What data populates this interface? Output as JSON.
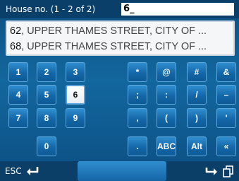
{
  "input": {
    "label": "House no.  (1 - 2 of 2)",
    "value": "6_"
  },
  "results": [
    {
      "number": "62",
      "rest": ", UPPER THAMES STREET, CITY OF ..."
    },
    {
      "number": "68",
      "rest": ", UPPER THAMES STREET, CITY OF ..."
    }
  ],
  "keys": {
    "k1": "1",
    "k2": "2",
    "k3": "3",
    "k4": "4",
    "k5": "5",
    "k6": "6",
    "k7": "7",
    "k8": "8",
    "k9": "9",
    "k0": "0",
    "star": "*",
    "at": "@",
    "hash": "#",
    "amp": "&",
    "semicolon": ";",
    "colon": ":",
    "slash": "/",
    "minus": "–",
    "comma": ",",
    "lparen": "(",
    "rparen": ")",
    "apostrophe": "'",
    "period": ".",
    "abc": "ABC",
    "alt": "Alt",
    "guillemet": "«"
  },
  "bottom": {
    "esc_label": "ESC"
  },
  "icons": {
    "backspace": "return-arrow-icon",
    "enter": "forward-arrow-icon",
    "pages": "pages-icon"
  }
}
